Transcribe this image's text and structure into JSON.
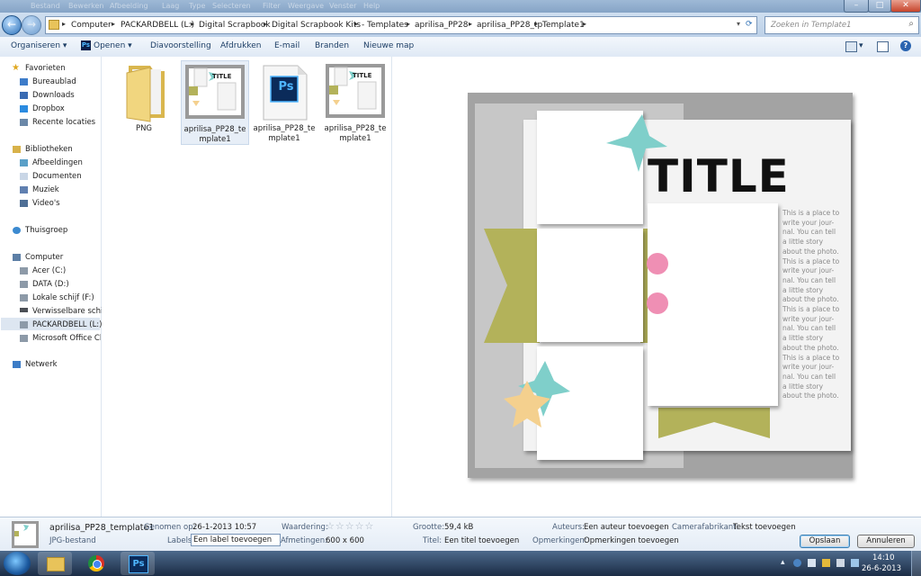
{
  "titlebar": {
    "ghost_menu": [
      "Bestand",
      "Bewerken",
      "Afbeelding",
      "Laag",
      "Type",
      "Selecteren",
      "Filter",
      "Weergave",
      "Venster",
      "Help"
    ],
    "minimize_label": "–",
    "maximize_label": "□",
    "close_label": "✕"
  },
  "address": {
    "back_label": "←",
    "forward_label": "→",
    "crumbs": [
      "Computer",
      "PACKARDBELL (L:)",
      "Digital Scrapbook",
      "Digital Scrapbook Kits",
      "- Templates",
      "aprilisa_PP28",
      "aprilisa_PP28_tp",
      "Template1"
    ],
    "search_placeholder": "Zoeken in Template1"
  },
  "toolbar": {
    "organize": "Organiseren",
    "open": "Openen",
    "slideshow": "Diavoorstelling",
    "print": "Afdrukken",
    "email": "E-mail",
    "burn": "Branden",
    "new_folder": "Nieuwe map",
    "open_icon_text": "Ps"
  },
  "nav": {
    "favorites": "Favorieten",
    "fav_items": [
      "Bureaublad",
      "Downloads",
      "Dropbox",
      "Recente locaties"
    ],
    "libraries": "Bibliotheken",
    "lib_items": [
      "Afbeeldingen",
      "Documenten",
      "Muziek",
      "Video's"
    ],
    "homegroup": "Thuisgroep",
    "computer": "Computer",
    "comp_items": [
      "Acer (C:)",
      "DATA (D:)",
      "Lokale schijf (F:)",
      "Verwisselbare schijf",
      "PACKARDBELL (L:)",
      "Microsoft Office Click"
    ],
    "network": "Netwerk"
  },
  "files": {
    "items": [
      {
        "name": "PNG"
      },
      {
        "name": "aprilisa_PP28_te mplate1"
      },
      {
        "name": "aprilisa_PP28_te mplate1"
      },
      {
        "name": "aprilisa_PP28_te mplate1"
      }
    ],
    "psd_icon_text": "Ps",
    "thumb_title": "TITLE"
  },
  "preview": {
    "title": "TITLE",
    "journal_lines": [
      "This is a place to",
      "write your jour-",
      "nal.  You can tell",
      "a little story",
      "about the photo.",
      "This is a place to",
      "write your jour-",
      "nal.  You can tell",
      "a little story",
      "about the photo.",
      "This is a place to",
      "write your jour-",
      "nal.  You can tell",
      "a little story",
      "about the photo.",
      "This is a place to",
      "write your jour-",
      "nal.  You can tell",
      "a little story",
      "about the photo."
    ],
    "colors": {
      "teal": "#7fcfca",
      "olive": "#b3b25a",
      "pink": "#ef8fb4",
      "peach": "#f4d08e"
    }
  },
  "details": {
    "filename": "aprilisa_PP28_template1",
    "filetype": "JPG-bestand",
    "taken_label": "Genomen op:",
    "taken_value": "26-1-2013 10:57",
    "labels_label": "Labels:",
    "labels_value": "Een label toevoegen",
    "rating_label": "Waardering:",
    "rating_stars": 0,
    "dimensions_label": "Afmetingen:",
    "dimensions_value": "600 x 600",
    "size_label": "Grootte:",
    "size_value": "59,4 kB",
    "title_label": "Titel:",
    "title_value": "Een titel toevoegen",
    "authors_label": "Auteurs:",
    "authors_value": "Een auteur toevoegen",
    "comments_label": "Opmerkingen:",
    "comments_value": "Opmerkingen toevoegen",
    "maker_label": "Camerafabrikant:",
    "maker_value": "Tekst toevoegen",
    "save_label": "Opslaan",
    "cancel_label": "Annuleren"
  },
  "taskbar": {
    "time": "14:10",
    "date": "26-6-2013",
    "ps_text": "Ps"
  }
}
